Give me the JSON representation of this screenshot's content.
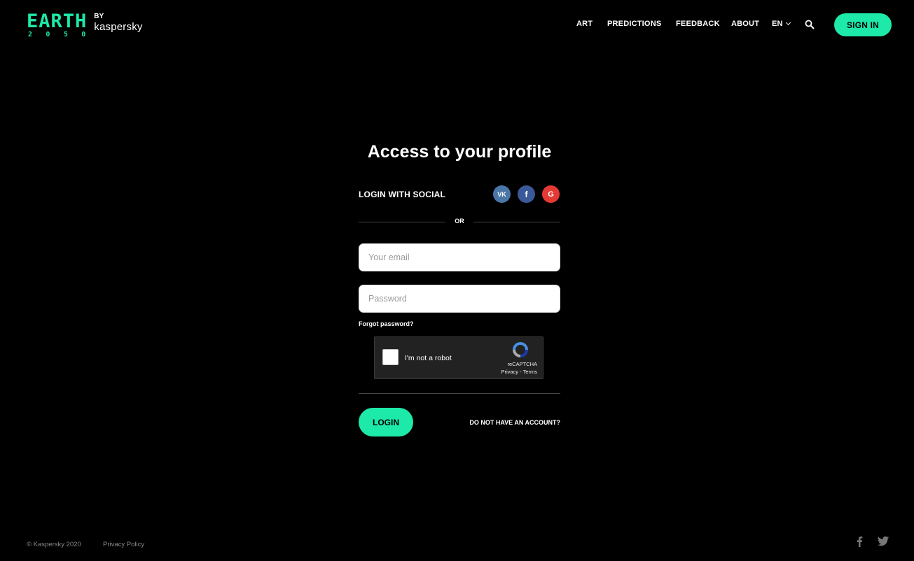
{
  "header": {
    "logo": {
      "word": "EARTH",
      "year": [
        "2",
        "0",
        "5",
        "0"
      ],
      "by": "BY",
      "brand": "kaspersky"
    },
    "nav": [
      {
        "label": "ART"
      },
      {
        "label": "PREDICTIONS"
      },
      {
        "label": "FEEDBACK"
      },
      {
        "label": "ABOUT"
      }
    ],
    "language": "EN",
    "signin_label": "SIGN IN"
  },
  "form": {
    "title": "Access to your profile",
    "social_label": "LOGIN WITH SOCIAL",
    "social": {
      "vk": "VK",
      "facebook": "f",
      "google": "G"
    },
    "or_text": "OR",
    "email_placeholder": "Your email",
    "email_value": "",
    "password_placeholder": "Password",
    "password_value": "",
    "forgot_label": "Forgot password?",
    "captcha": {
      "text": "I'm not a robot",
      "brand": "reCAPTCHA",
      "links": "Privacy - Terms"
    },
    "login_label": "LOGIN",
    "no_account_label": "DO NOT HAVE AN ACCOUNT?"
  },
  "footer": {
    "copyright": "© Kaspersky 2020",
    "privacy": "Privacy Policy"
  },
  "colors": {
    "accent": "#1de9a8",
    "background": "#000000",
    "vk": "#4a76a8",
    "facebook": "#3b5998",
    "google": "#e53935"
  },
  "icons": [
    "search-icon",
    "vk-icon",
    "facebook-icon",
    "google-icon",
    "chevron-down-icon",
    "recaptcha-icon",
    "twitter-icon"
  ]
}
